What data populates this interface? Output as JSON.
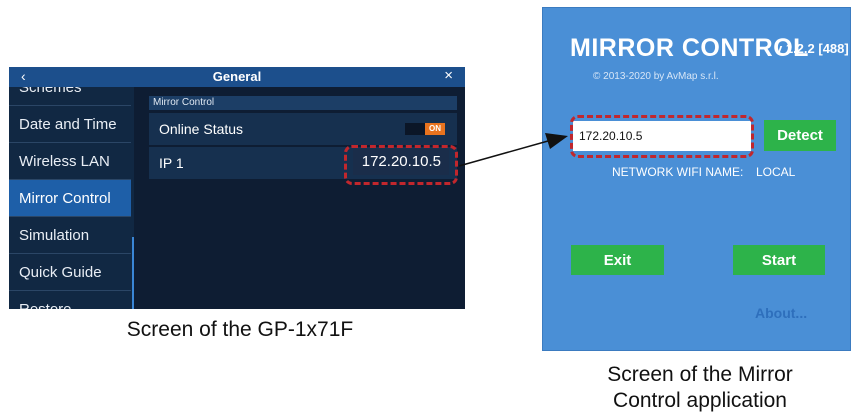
{
  "gp": {
    "title": "General",
    "back_icon": "‹",
    "close_icon": "×",
    "sidebar": [
      {
        "label": "Schemes"
      },
      {
        "label": "Date and Time"
      },
      {
        "label": "Wireless LAN"
      },
      {
        "label": "Mirror Control"
      },
      {
        "label": "Simulation"
      },
      {
        "label": "Quick Guide"
      },
      {
        "label": "Restore"
      }
    ],
    "section_header": "Mirror Control",
    "online_status_label": "Online Status",
    "toggle_state": "ON",
    "ip_label": "IP 1",
    "ip_value": "172.20.10.5",
    "caption": "Screen of the GP-1x71F"
  },
  "mirror": {
    "title": "MIRROR CONTROL",
    "version": "v 1.2.2 [488]",
    "copyright": "© 2013-2020 by AvMap s.r.l.",
    "ip_input_value": "172.20.10.5",
    "detect_label": "Detect",
    "wifi_label": "NETWORK WIFI NAME:",
    "wifi_value": "LOCAL",
    "exit_label": "Exit",
    "start_label": "Start",
    "about_label": "About...",
    "caption_line1": "Screen of the Mirror",
    "caption_line2": "Control application"
  },
  "colors": {
    "highlight": "#c1272d",
    "gp_accent": "#1e5fa8",
    "toggle_on": "#e8731e",
    "mirror_bg": "#4a8fd6",
    "button_green": "#2db34a"
  }
}
